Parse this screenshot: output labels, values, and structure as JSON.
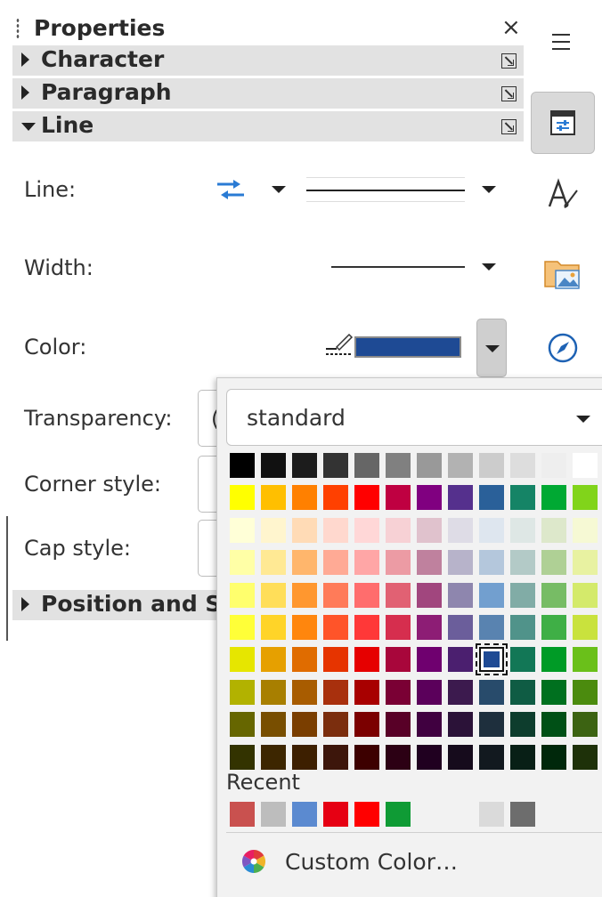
{
  "sidebar_title": "Properties",
  "close_glyph": "×",
  "panels": {
    "character": "Character",
    "paragraph": "Paragraph",
    "line": "Line",
    "position": "Position and S"
  },
  "line_panel": {
    "line_label": "Line:",
    "width_label": "Width:",
    "color_label": "Color:",
    "transparency_label": "Transparency:",
    "corner_label": "Corner style:",
    "cap_label": "Cap style:",
    "transparency_value_partial": "(",
    "current_color": "#1e4a94"
  },
  "color_popup": {
    "palette": "standard",
    "recent_label": "Recent",
    "custom_label": "Custom Color…",
    "selected_color": "#1e4a94",
    "grid": [
      [
        "#000000",
        "#111111",
        "#1c1c1c",
        "#333333",
        "#666666",
        "#808080",
        "#999999",
        "#b2b2b2",
        "#cccccc",
        "#dddddd",
        "#eeeeee",
        "#ffffff"
      ],
      [
        "#ffff00",
        "#ffbf00",
        "#ff8000",
        "#ff4000",
        "#ff0000",
        "#bf0041",
        "#800080",
        "#55308d",
        "#2a6099",
        "#158466",
        "#00a933",
        "#81d41a"
      ],
      [
        "#ffffd7",
        "#fff5ce",
        "#ffdbb6",
        "#ffd8ce",
        "#ffd7d7",
        "#f7d1d5",
        "#e0c2cd",
        "#dedce6",
        "#dee6ef",
        "#dee7e5",
        "#dde8cb",
        "#f6f9d4"
      ],
      [
        "#ffffa6",
        "#ffe994",
        "#ffb66c",
        "#ffaa95",
        "#ffa6a6",
        "#ec9ba4",
        "#bf819e",
        "#b7b3ca",
        "#b4c7dc",
        "#b3cac7",
        "#afd095",
        "#e8f2a1"
      ],
      [
        "#ffff6d",
        "#ffde59",
        "#ff972f",
        "#ff7b59",
        "#ff6d6d",
        "#e16173",
        "#a1467e",
        "#8e86ae",
        "#729fcf",
        "#81aca6",
        "#77bc65",
        "#d4ea6b"
      ],
      [
        "#ffff38",
        "#ffd428",
        "#ff860d",
        "#ff5429",
        "#ff3838",
        "#d62e4e",
        "#8d1d75",
        "#6b5e9b",
        "#5983b0",
        "#50938a",
        "#3faf46",
        "#c9e23d"
      ],
      [
        "#e6e600",
        "#e6a000",
        "#e06c00",
        "#e63400",
        "#e60000",
        "#a8063b",
        "#6f006f",
        "#4b1f6f",
        "#1e4a94",
        "#127756",
        "#009b26",
        "#6ac01a"
      ],
      [
        "#b2b200",
        "#a87f00",
        "#a85c00",
        "#a8300d",
        "#a80000",
        "#7a0034",
        "#5b005b",
        "#3c1a4e",
        "#284b6b",
        "#0f5c44",
        "#00701f",
        "#4b8b0e"
      ],
      [
        "#666600",
        "#784e00",
        "#7a3e00",
        "#7b2e0e",
        "#7b0000",
        "#580027",
        "#400040",
        "#2b1238",
        "#1e2f3d",
        "#0d3d2d",
        "#005016",
        "#3c6312"
      ],
      [
        "#333300",
        "#3d2600",
        "#3d1f00",
        "#3d160b",
        "#3d0000",
        "#2c0014",
        "#200020",
        "#160b1c",
        "#12191f",
        "#081f16",
        "#00280b",
        "#1e3109"
      ]
    ],
    "recent": [
      "#c9514f",
      "#bdbdbd",
      "#5b8ad0",
      "#e60013",
      "#ff0000",
      "#0f9b35",
      "#f2f2f2",
      "#f2f2f2",
      "#dadada",
      "#6d6d6d"
    ]
  },
  "tabs": {
    "menu": "hamburger-icon",
    "properties": "properties-icon",
    "styles": "styles-icon",
    "gallery": "gallery-icon",
    "navigator": "navigator-icon"
  }
}
